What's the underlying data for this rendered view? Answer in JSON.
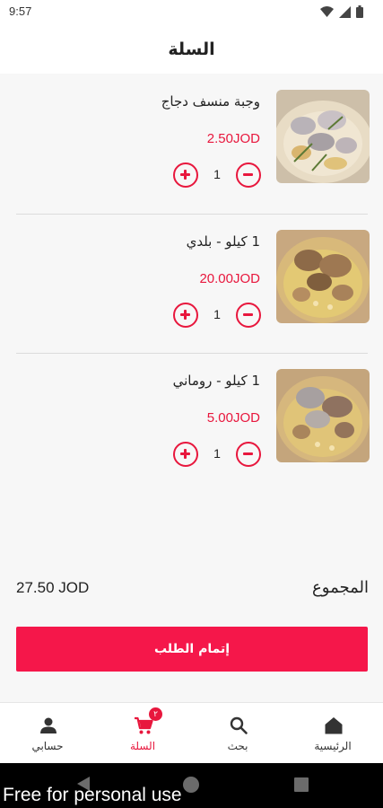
{
  "status_bar": {
    "time": "9:57"
  },
  "header": {
    "title": "السلة"
  },
  "cart": {
    "items": [
      {
        "name": "وجبة منسف دجاج",
        "price": "2.50JOD",
        "quantity": "1"
      },
      {
        "name": "1 كيلو - بلدي",
        "price": "20.00JOD",
        "quantity": "1"
      },
      {
        "name": "1 كيلو - روماني",
        "price": "5.00JOD",
        "quantity": "1"
      }
    ]
  },
  "summary": {
    "total_label": "المجموع",
    "total_value": "27.50 JOD"
  },
  "checkout": {
    "label": "إتمام الطلب"
  },
  "bottom_nav": {
    "items": [
      {
        "label": "حسابي",
        "icon": "person-icon"
      },
      {
        "label": "السلة",
        "icon": "cart-icon",
        "badge": "٢"
      },
      {
        "label": "بحث",
        "icon": "search-icon"
      },
      {
        "label": "الرئيسية",
        "icon": "home-icon"
      }
    ]
  },
  "watermark": "Free for personal use",
  "colors": {
    "accent": "#e8173d",
    "button": "#f5174a",
    "background": "#f7f7f7"
  }
}
